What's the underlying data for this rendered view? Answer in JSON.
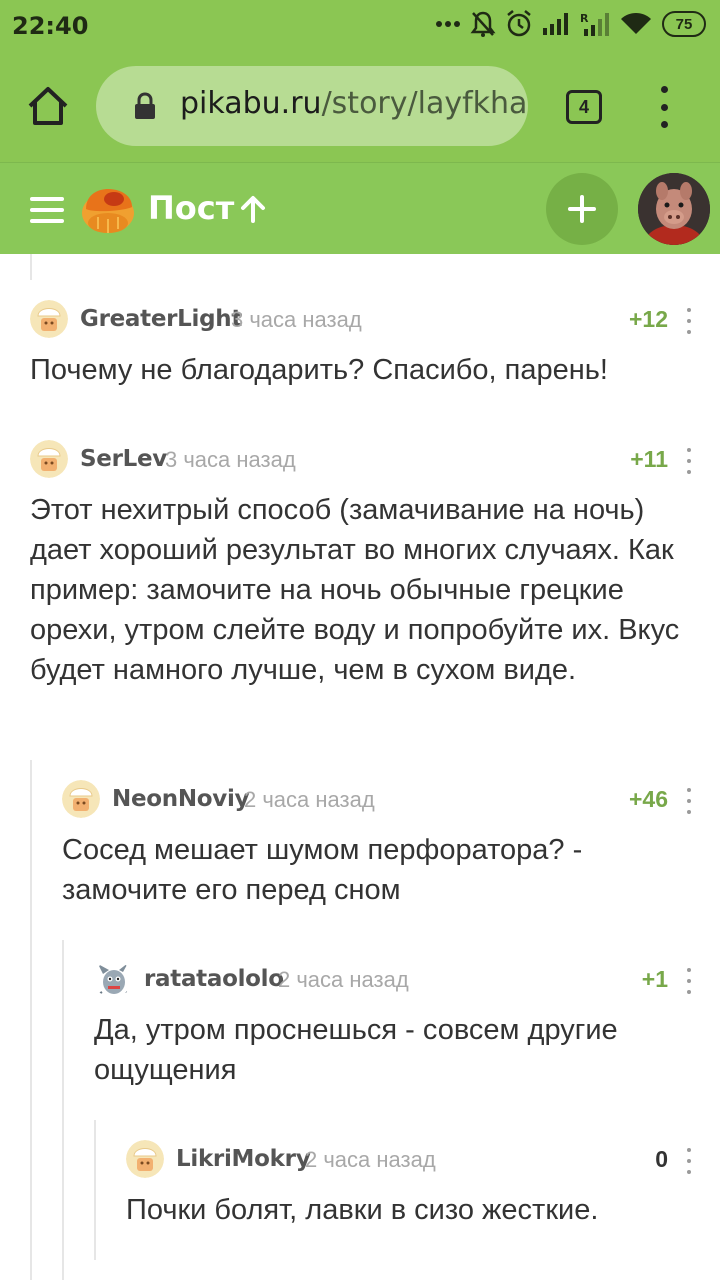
{
  "status_bar": {
    "time": "22:40",
    "battery": "75",
    "icons": [
      "dots-icon",
      "mute-icon",
      "alarm-icon",
      "signal-icon",
      "signal-r-icon",
      "wifi-icon",
      "battery-icon"
    ]
  },
  "browser": {
    "url_host": "pikabu.ru",
    "url_path": "/story/layfkha",
    "tab_count": "4"
  },
  "header": {
    "title": "Пост"
  },
  "colors": {
    "brand_green": "#8ac858",
    "score_green": "#78a84a"
  },
  "comments": [
    {
      "author": "GreaterLight",
      "time": "3 часа назад",
      "score": "+12",
      "text": "Почему не благодарить? Спасибо, парень!"
    },
    {
      "author": "SerLev",
      "time": "3 часа назад",
      "score": "+11",
      "text": "Этот нехитрый способ (замачивание на ночь) дает хороший результат во многих случаях. Как пример: замочите на ночь обычные грецкие орехи, утром слейте воду и попробуйте их. Вкус будет намного лучше, чем в сухом виде."
    },
    {
      "author": "NeonNoviy",
      "time": "2 часа назад",
      "score": "+46",
      "text": "Сосед мешает шумом перфоратора? - замочите его перед сном"
    },
    {
      "author": "ratataololo",
      "time": "2 часа назад",
      "score": "+1",
      "text": "Да, утром проснешься - совсем другие ощущения"
    },
    {
      "author": "LikriMokry",
      "time": "2 часа назад",
      "score": "0",
      "text": "Почки болят, лавки в сизо жесткие."
    }
  ]
}
